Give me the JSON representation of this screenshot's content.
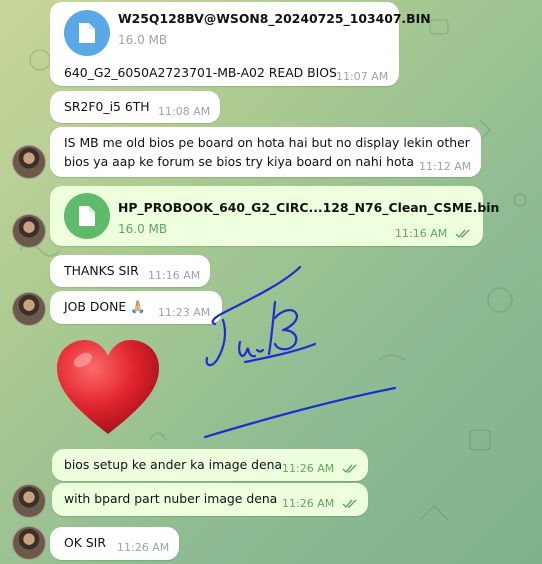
{
  "messages": {
    "m1": {
      "file_name": "W25Q128BV@WSON8_20240725_103407.BIN",
      "file_size": "16.0 MB",
      "caption": "640_G2_6050A2723701-MB-A02 READ BIOS",
      "time": "11:07 AM"
    },
    "m2": {
      "text": "SR2F0_i5  6TH",
      "time": "11:08 AM"
    },
    "m3": {
      "line1": "IS MB me old bios pe board on hota hai but no display lekin other",
      "line2": "bios ya aap ke forum se bios try kiya board on nahi hota",
      "time": "11:12 AM"
    },
    "m4": {
      "file_name": "HP_PROBOOK_640_G2_CIRC...128_N76_Clean_CSME.bin",
      "file_size": "16.0 MB",
      "time": "11:16 AM"
    },
    "m5": {
      "text": "THANKS SIR",
      "time": "11:16 AM"
    },
    "m6": {
      "text": "JOB DONE 🙏🏼",
      "time": "11:23 AM"
    },
    "m7": {
      "emoji": "❤️"
    },
    "m8": {
      "text": "bios setup ke ander ka image dena",
      "time": "11:26 AM"
    },
    "m9": {
      "text": "with bpard part nuber image dena",
      "time": "11:26 AM"
    },
    "m10": {
      "text": "OK SIR",
      "time": "11:26 AM"
    }
  },
  "colors": {
    "file_icon_incoming": "#5aa8e6",
    "file_icon_outgoing": "#5fba6a",
    "signature_ink": "#1a2fd0",
    "heart": "#e0242e"
  }
}
